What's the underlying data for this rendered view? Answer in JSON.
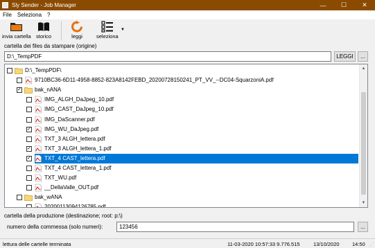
{
  "window": {
    "title": "Sly Sender - Job Manager",
    "controls": {
      "minimize": "—",
      "maximize": "☐",
      "close": "✕"
    }
  },
  "menu": [
    "File",
    "Seleziona",
    "?"
  ],
  "toolbar": {
    "invia_label": "invia cartella",
    "storico_label": "storico",
    "leggi_label": "leggi",
    "seleziona_label": "seleziona"
  },
  "origin": {
    "label": "cartella dei files da stampare (origine)",
    "path": "D:\\_TempPDF",
    "leggi_button": "LEGGI",
    "browse_button": "..."
  },
  "tree": {
    "rows": [
      {
        "text": "D:\\_TempPDF\\",
        "type": "folder",
        "checked": false,
        "level": 0
      },
      {
        "text": "9710BC36-6D11-4958-8852-823A8142FEBD_20200728150241_PT_VV_--DC04-SquarzoniA.pdf",
        "type": "pdf",
        "checked": false,
        "level": 1
      },
      {
        "text": "bak_nANA",
        "type": "folder",
        "checked": true,
        "level": 1
      },
      {
        "text": "IMG_ALGH_DaJpeg_10.pdf",
        "type": "pdf",
        "checked": false,
        "level": 2
      },
      {
        "text": "IMG_CAST_DaJpeg_10.pdf",
        "type": "pdf",
        "checked": false,
        "level": 2
      },
      {
        "text": "IMG_DaScanner.pdf",
        "type": "pdf",
        "checked": false,
        "level": 2
      },
      {
        "text": "IMG_WU_DaJpeg.pdf",
        "type": "pdf",
        "checked": true,
        "level": 2
      },
      {
        "text": "TXT_3 ALGH_lettera.pdf",
        "type": "pdf",
        "checked": false,
        "level": 2
      },
      {
        "text": "TXT_3 ALGH_lettera_1.pdf",
        "type": "pdf",
        "checked": true,
        "level": 2
      },
      {
        "text": "TXT_4 CAST_lettera.pdf",
        "type": "pdf",
        "checked": true,
        "level": 2,
        "selected": true
      },
      {
        "text": "TXT_4 CAST_lettera_1.pdf",
        "type": "pdf",
        "checked": false,
        "level": 2
      },
      {
        "text": "TXT_WU.pdf",
        "type": "pdf",
        "checked": false,
        "level": 2
      },
      {
        "text": "__DellaValle_OUT.pdf",
        "type": "pdf",
        "checked": false,
        "level": 2
      },
      {
        "text": "bak_wANA",
        "type": "folder",
        "checked": false,
        "level": 1
      },
      {
        "text": "20200113094126785.pdf",
        "type": "pdf",
        "checked": false,
        "level": 2
      }
    ],
    "scroll_up": "▲",
    "scroll_down": "▼"
  },
  "production": {
    "label": "cartella della produzione (destinazione; root: p:\\)",
    "commessa_label": "numero della commessa (solo numeri):",
    "commessa_value": "123456",
    "browse_button": "..."
  },
  "status": {
    "message": "lettura delle cartelle terminata",
    "timestamp": "11-03-2020 10:57:33 9.776.515",
    "date": "13/10/2020",
    "time": "14:50"
  },
  "colors": {
    "titlebar": "#8a4a00",
    "selection": "#0078d7"
  }
}
